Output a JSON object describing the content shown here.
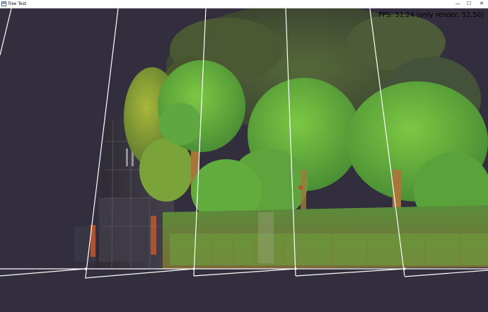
{
  "window": {
    "title": "Tree Test",
    "controls": {
      "minimize": "—",
      "maximize": "☐",
      "close": "✕"
    }
  },
  "hud": {
    "fps_text": "FPS: 51.24 (only render: 52.50)"
  },
  "colors": {
    "background": "#332e3d",
    "foliage_dark": "#4a5a33",
    "foliage_light": "#6fb83c",
    "grid_line": "#ffffff"
  }
}
